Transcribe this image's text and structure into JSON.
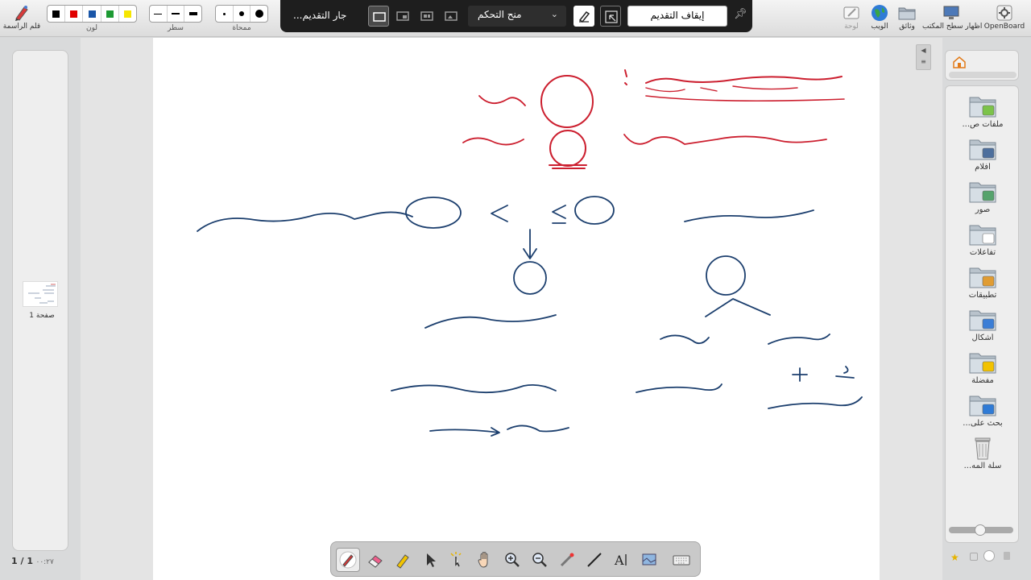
{
  "toolbar": {
    "pen_label": "قلم الراسمة",
    "color_label": "لون",
    "line_label": "سطر",
    "eraser_label": "ممحاة",
    "colors": [
      "#000000",
      "#e00000",
      "#1a56a8",
      "#1d9a33",
      "#f6e600"
    ],
    "board_label": "لوحة",
    "web_label": "الويب",
    "docs_label": "وثائق",
    "desktop_label": "اظهار سطح المكتب",
    "openboard_label": "OpenBoard"
  },
  "presentation_bar": {
    "slideshow_label": "...جار التقديم",
    "control_label": "منح التحكم",
    "stop_label": "إيقاف التقديم"
  },
  "pages": {
    "page_label": "صفحة 1",
    "page_count": "1 / 1",
    "timer": "٠٠:٢٧"
  },
  "library": {
    "items": [
      {
        "label": "...ملفات ص",
        "icon": "audio-folder-icon"
      },
      {
        "label": "أفلام",
        "icon": "film-folder-icon"
      },
      {
        "label": "صور",
        "icon": "image-folder-icon"
      },
      {
        "label": "تفاعلات",
        "icon": "interactive-folder-icon"
      },
      {
        "label": "تطبيقات",
        "icon": "apps-folder-icon"
      },
      {
        "label": "أشكال",
        "icon": "shapes-folder-icon"
      },
      {
        "label": "مفضلة",
        "icon": "favorite-folder-icon"
      },
      {
        "label": "...بحث على",
        "icon": "web-search-folder-icon"
      },
      {
        "label": "...سلة المه",
        "icon": "trash-icon"
      }
    ]
  },
  "board": {
    "ink": {
      "title": "الارتباط الخطي البسيط :",
      "population": "المجتمع",
      "population_symbol": "ρ",
      "sample": "العينة",
      "sample_symbol": "r",
      "phenomena": "ظاهرتين ( متغيرين )",
      "range_left": "+1",
      "range_middle": "≥ r ≥",
      "range_right": "-1",
      "perfect_positive": "ارتباط طردي تام",
      "perfect_negative": "ارتباط عكسي (سلبي) تام",
      "zero": "0",
      "no_correlation": "لا يوجد ارتباط",
      "r_symbol": "r",
      "sign": "الإشارة",
      "sign_values": "- ، +",
      "direction": "اتجاه العلاقة",
      "value": "القيمة",
      "strength": "قوة العلاقة",
      "method1": "- طريقة بيرسون .",
      "method2": "- طريقة ـــــ"
    },
    "ink_colors": {
      "red": "#cc1f2f",
      "blue": "#1c3f6e"
    }
  }
}
